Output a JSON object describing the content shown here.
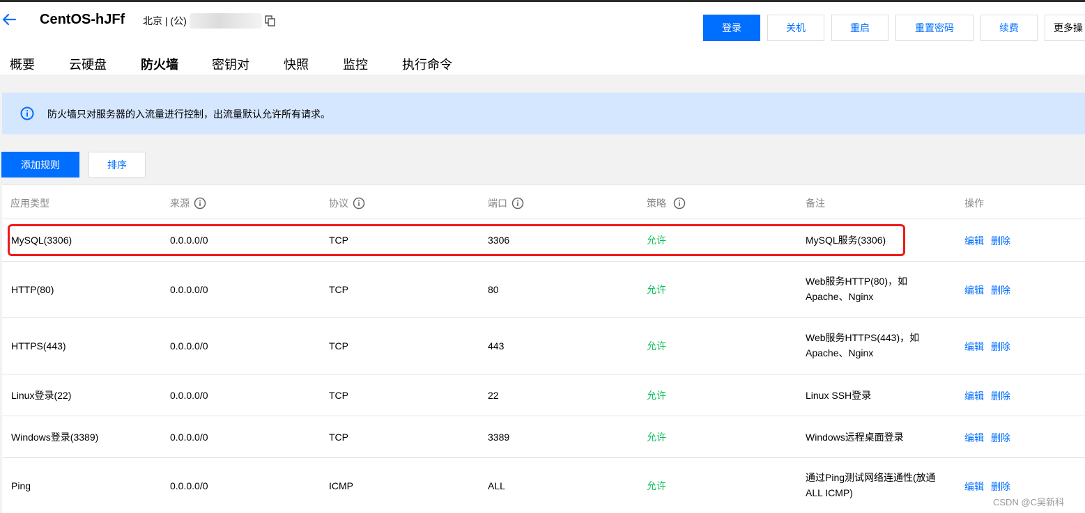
{
  "header": {
    "title": "CentOS-hJFf",
    "region": "北京 | (公)",
    "buttons": {
      "login": "登录",
      "shutdown": "关机",
      "restart": "重启",
      "reset_password": "重置密码",
      "renew": "续费",
      "more": "更多操"
    }
  },
  "tabs": [
    "概要",
    "云硬盘",
    "防火墙",
    "密钥对",
    "快照",
    "监控",
    "执行命令"
  ],
  "active_tab": "防火墙",
  "notice": "防火墙只对服务器的入流量进行控制，出流量默认允许所有请求。",
  "actions": {
    "add_rule": "添加规则",
    "sort": "排序"
  },
  "table": {
    "columns": [
      "应用类型",
      "来源",
      "协议",
      "端口",
      "策略",
      "备注",
      "操作"
    ],
    "rows": [
      {
        "app": "MySQL(3306)",
        "source": "0.0.0.0/0",
        "protocol": "TCP",
        "port": "3306",
        "policy": "允许",
        "note": "MySQL服务(3306)",
        "note2": "",
        "edit": "编辑",
        "delete": "删除"
      },
      {
        "app": "HTTP(80)",
        "source": "0.0.0.0/0",
        "protocol": "TCP",
        "port": "80",
        "policy": "允许",
        "note": "Web服务HTTP(80)，如",
        "note2": "Apache、Nginx",
        "edit": "编辑",
        "delete": "删除"
      },
      {
        "app": "HTTPS(443)",
        "source": "0.0.0.0/0",
        "protocol": "TCP",
        "port": "443",
        "policy": "允许",
        "note": "Web服务HTTPS(443)，如",
        "note2": "Apache、Nginx",
        "edit": "编辑",
        "delete": "删除"
      },
      {
        "app": "Linux登录(22)",
        "source": "0.0.0.0/0",
        "protocol": "TCP",
        "port": "22",
        "policy": "允许",
        "note": "Linux SSH登录",
        "note2": "",
        "edit": "编辑",
        "delete": "删除"
      },
      {
        "app": "Windows登录(3389)",
        "source": "0.0.0.0/0",
        "protocol": "TCP",
        "port": "3389",
        "policy": "允许",
        "note": "Windows远程桌面登录",
        "note2": "",
        "edit": "编辑",
        "delete": "删除"
      },
      {
        "app": "Ping",
        "source": "0.0.0.0/0",
        "protocol": "ICMP",
        "port": "ALL",
        "policy": "允许",
        "note": "通过Ping测试网络连通性(放通",
        "note2": "ALL ICMP)",
        "edit": "编辑",
        "delete": "删除"
      }
    ]
  },
  "watermark": "CSDN @C吴新科",
  "colors": {
    "primary": "#006eff",
    "allow": "#0abf5b",
    "notice_bg": "#d5e7ff",
    "highlight": "#f01a1a"
  }
}
